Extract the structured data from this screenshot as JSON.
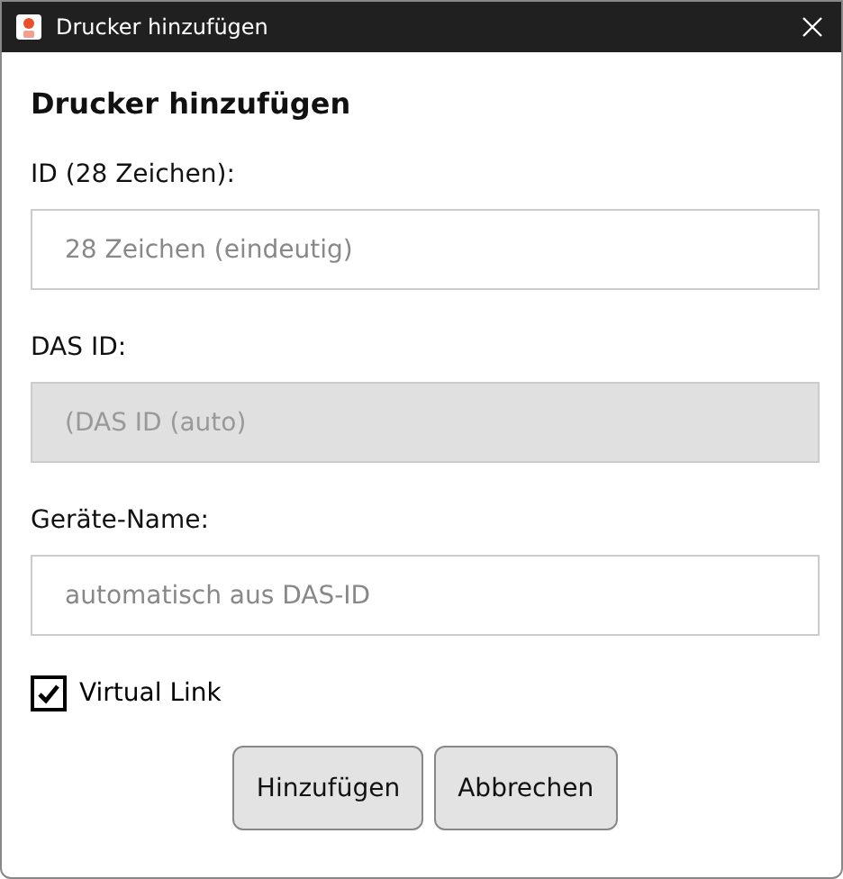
{
  "window": {
    "title": "Drucker hinzufügen"
  },
  "heading": "Drucker hinzufügen",
  "fields": [
    {
      "label": "ID (28 Zeichen):",
      "placeholder": "28 Zeichen (eindeutig)",
      "disabled": false
    },
    {
      "label": "DAS ID:",
      "placeholder": "(DAS ID (auto)",
      "disabled": true
    },
    {
      "label": "Geräte-Name:",
      "placeholder": "automatisch aus DAS-ID",
      "disabled": false
    }
  ],
  "checkbox": {
    "label": "Virtual Link",
    "checked": true
  },
  "buttons": [
    "Hinzufügen",
    "Abbrechen"
  ]
}
